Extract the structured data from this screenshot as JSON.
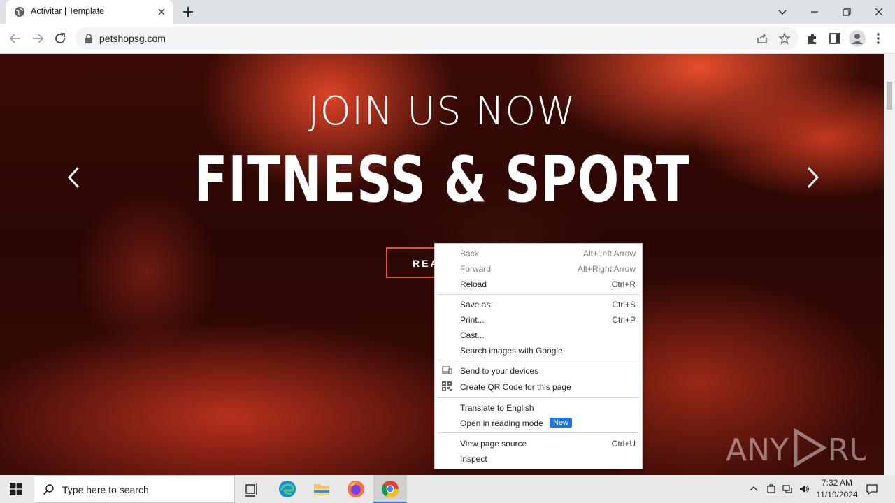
{
  "browser": {
    "tab": {
      "title": "Activitar | Template"
    },
    "url": "petshopsg.com"
  },
  "page": {
    "hero_subtitle": "JOIN US NOW",
    "hero_title": "FITNESS & SPORT",
    "read_button": "REA",
    "watermark": "ANY  RUN"
  },
  "context_menu": {
    "items": [
      {
        "label": "Back",
        "shortcut": "Alt+Left Arrow"
      },
      {
        "label": "Forward",
        "shortcut": "Alt+Right Arrow"
      },
      {
        "label": "Reload",
        "shortcut": "Ctrl+R"
      },
      {
        "label": "Save as...",
        "shortcut": "Ctrl+S"
      },
      {
        "label": "Print...",
        "shortcut": "Ctrl+P"
      },
      {
        "label": "Cast...",
        "shortcut": ""
      },
      {
        "label": "Search images with Google",
        "shortcut": ""
      },
      {
        "label": "Send to your devices",
        "shortcut": ""
      },
      {
        "label": "Create QR Code for this page",
        "shortcut": ""
      },
      {
        "label": "Translate to English",
        "shortcut": ""
      },
      {
        "label": "Open in reading mode",
        "shortcut": "",
        "badge": "New"
      },
      {
        "label": "View page source",
        "shortcut": "Ctrl+U"
      },
      {
        "label": "Inspect",
        "shortcut": ""
      }
    ]
  },
  "taskbar": {
    "search_placeholder": "Type here to search",
    "time": "7:32 AM",
    "date": "11/19/2024"
  },
  "colors": {
    "accent_red": "#e8502a",
    "badge_blue": "#1a73e8"
  }
}
